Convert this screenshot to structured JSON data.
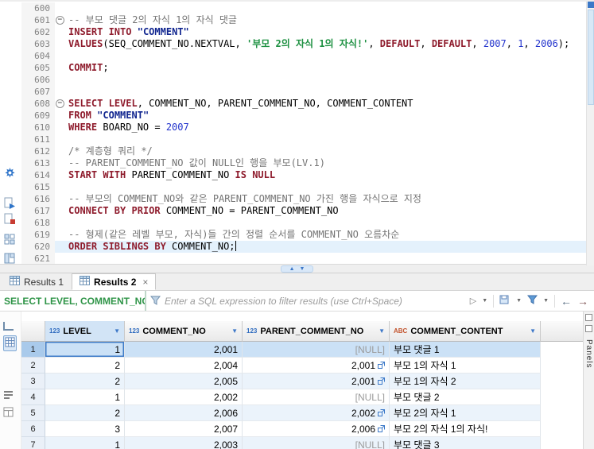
{
  "editor": {
    "current_line": 620,
    "fold_lines": [
      601,
      608
    ],
    "lines": [
      {
        "n": 600,
        "seg": []
      },
      {
        "n": 601,
        "seg": [
          [
            "c",
            "-- 부모 댓글 2의 자식 1의 자식 댓글"
          ]
        ]
      },
      {
        "n": 602,
        "seg": [
          [
            "k",
            "INSERT INTO"
          ],
          [
            "p",
            " "
          ],
          [
            "q",
            "\"COMMENT\""
          ]
        ]
      },
      {
        "n": 603,
        "seg": [
          [
            "k",
            "VALUES"
          ],
          [
            "p",
            "(SEQ_COMMENT_NO.NEXTVAL, "
          ],
          [
            "s",
            "'부모 2의 자식 1의 자식!'"
          ],
          [
            "p",
            ", "
          ],
          [
            "k",
            "DEFAULT"
          ],
          [
            "p",
            ", "
          ],
          [
            "k",
            "DEFAULT"
          ],
          [
            "p",
            ", "
          ],
          [
            "n",
            "2007"
          ],
          [
            "p",
            ", "
          ],
          [
            "n",
            "1"
          ],
          [
            "p",
            ", "
          ],
          [
            "n",
            "2006"
          ],
          [
            "p",
            ");"
          ]
        ]
      },
      {
        "n": 604,
        "seg": []
      },
      {
        "n": 605,
        "seg": [
          [
            "k",
            "COMMIT"
          ],
          [
            "p",
            ";"
          ]
        ]
      },
      {
        "n": 606,
        "seg": []
      },
      {
        "n": 607,
        "seg": []
      },
      {
        "n": 608,
        "seg": [
          [
            "k",
            "SELECT"
          ],
          [
            "p",
            " "
          ],
          [
            "k",
            "LEVEL"
          ],
          [
            "p",
            ", COMMENT_NO, PARENT_COMMENT_NO, COMMENT_CONTENT"
          ]
        ]
      },
      {
        "n": 609,
        "seg": [
          [
            "k",
            "FROM"
          ],
          [
            "p",
            " "
          ],
          [
            "q",
            "\"COMMENT\""
          ]
        ]
      },
      {
        "n": 610,
        "seg": [
          [
            "k",
            "WHERE"
          ],
          [
            "p",
            " BOARD_NO = "
          ],
          [
            "n",
            "2007"
          ]
        ]
      },
      {
        "n": 611,
        "seg": []
      },
      {
        "n": 612,
        "seg": [
          [
            "c",
            "/* 계층형 쿼리 */"
          ]
        ]
      },
      {
        "n": 613,
        "seg": [
          [
            "c",
            "-- PARENT_COMMENT_NO 값이 NULL인 행을 부모(LV.1)"
          ]
        ]
      },
      {
        "n": 614,
        "seg": [
          [
            "k",
            "START WITH"
          ],
          [
            "p",
            " PARENT_COMMENT_NO "
          ],
          [
            "k",
            "IS NULL"
          ]
        ]
      },
      {
        "n": 615,
        "seg": []
      },
      {
        "n": 616,
        "seg": [
          [
            "c",
            "-- 부모의 COMMENT_NO와 같은 PARENT_COMMENT_NO 가진 행을 자식으로 지정"
          ]
        ]
      },
      {
        "n": 617,
        "seg": [
          [
            "k",
            "CONNECT BY PRIOR"
          ],
          [
            "p",
            " COMMENT_NO = PARENT_COMMENT_NO"
          ]
        ]
      },
      {
        "n": 618,
        "seg": []
      },
      {
        "n": 619,
        "seg": [
          [
            "c",
            "-- 형제(같은 레벨 부모, 자식)들 간의 정렬 순서를 COMMENT_NO 오름차순"
          ]
        ]
      },
      {
        "n": 620,
        "seg": [
          [
            "k",
            "ORDER SIBLINGS BY"
          ],
          [
            "p",
            " COMMENT_NO;"
          ]
        ]
      },
      {
        "n": 621,
        "seg": []
      }
    ]
  },
  "results": {
    "tabs": [
      {
        "label": "Results 1",
        "active": false
      },
      {
        "label": "Results 2",
        "active": true,
        "closable": true
      }
    ],
    "filter": {
      "query_ref": "SELECT LEVEL, COMMENT_NC",
      "placeholder": "Enter a SQL expression to filter results (use Ctrl+Space)"
    },
    "panels_label": "Panels",
    "grid": {
      "columns": [
        {
          "type": "123",
          "name": "LEVEL",
          "selected": true
        },
        {
          "type": "123",
          "name": "COMMENT_NO"
        },
        {
          "type": "123",
          "name": "PARENT_COMMENT_NO"
        },
        {
          "type": "ABC",
          "name": "COMMENT_CONTENT"
        }
      ],
      "rows": [
        {
          "num": 1,
          "selected": true,
          "cells": [
            {
              "v": "1",
              "focused": true
            },
            {
              "v": "2,001"
            },
            {
              "v": "[NULL]",
              "isnull": true
            },
            {
              "v": "부모 댓글 1"
            }
          ]
        },
        {
          "num": 2,
          "cells": [
            {
              "v": "2"
            },
            {
              "v": "2,004"
            },
            {
              "v": "2,001",
              "link": true
            },
            {
              "v": "부모 1의 자식 1"
            }
          ]
        },
        {
          "num": 3,
          "cells": [
            {
              "v": "2"
            },
            {
              "v": "2,005"
            },
            {
              "v": "2,001",
              "link": true
            },
            {
              "v": "부모 1의 자식 2"
            }
          ]
        },
        {
          "num": 4,
          "cells": [
            {
              "v": "1"
            },
            {
              "v": "2,002"
            },
            {
              "v": "[NULL]",
              "isnull": true
            },
            {
              "v": "부모 댓글 2"
            }
          ]
        },
        {
          "num": 5,
          "cells": [
            {
              "v": "2"
            },
            {
              "v": "2,006"
            },
            {
              "v": "2,002",
              "link": true
            },
            {
              "v": "부모 2의 자식 1"
            }
          ]
        },
        {
          "num": 6,
          "cells": [
            {
              "v": "3"
            },
            {
              "v": "2,007"
            },
            {
              "v": "2,006",
              "link": true
            },
            {
              "v": "부모 2의 자식 1의 자식!"
            }
          ]
        },
        {
          "num": 7,
          "cells": [
            {
              "v": "1"
            },
            {
              "v": "2,003"
            },
            {
              "v": "[NULL]",
              "isnull": true
            },
            {
              "v": "부모 댓글 3"
            }
          ]
        }
      ]
    }
  }
}
